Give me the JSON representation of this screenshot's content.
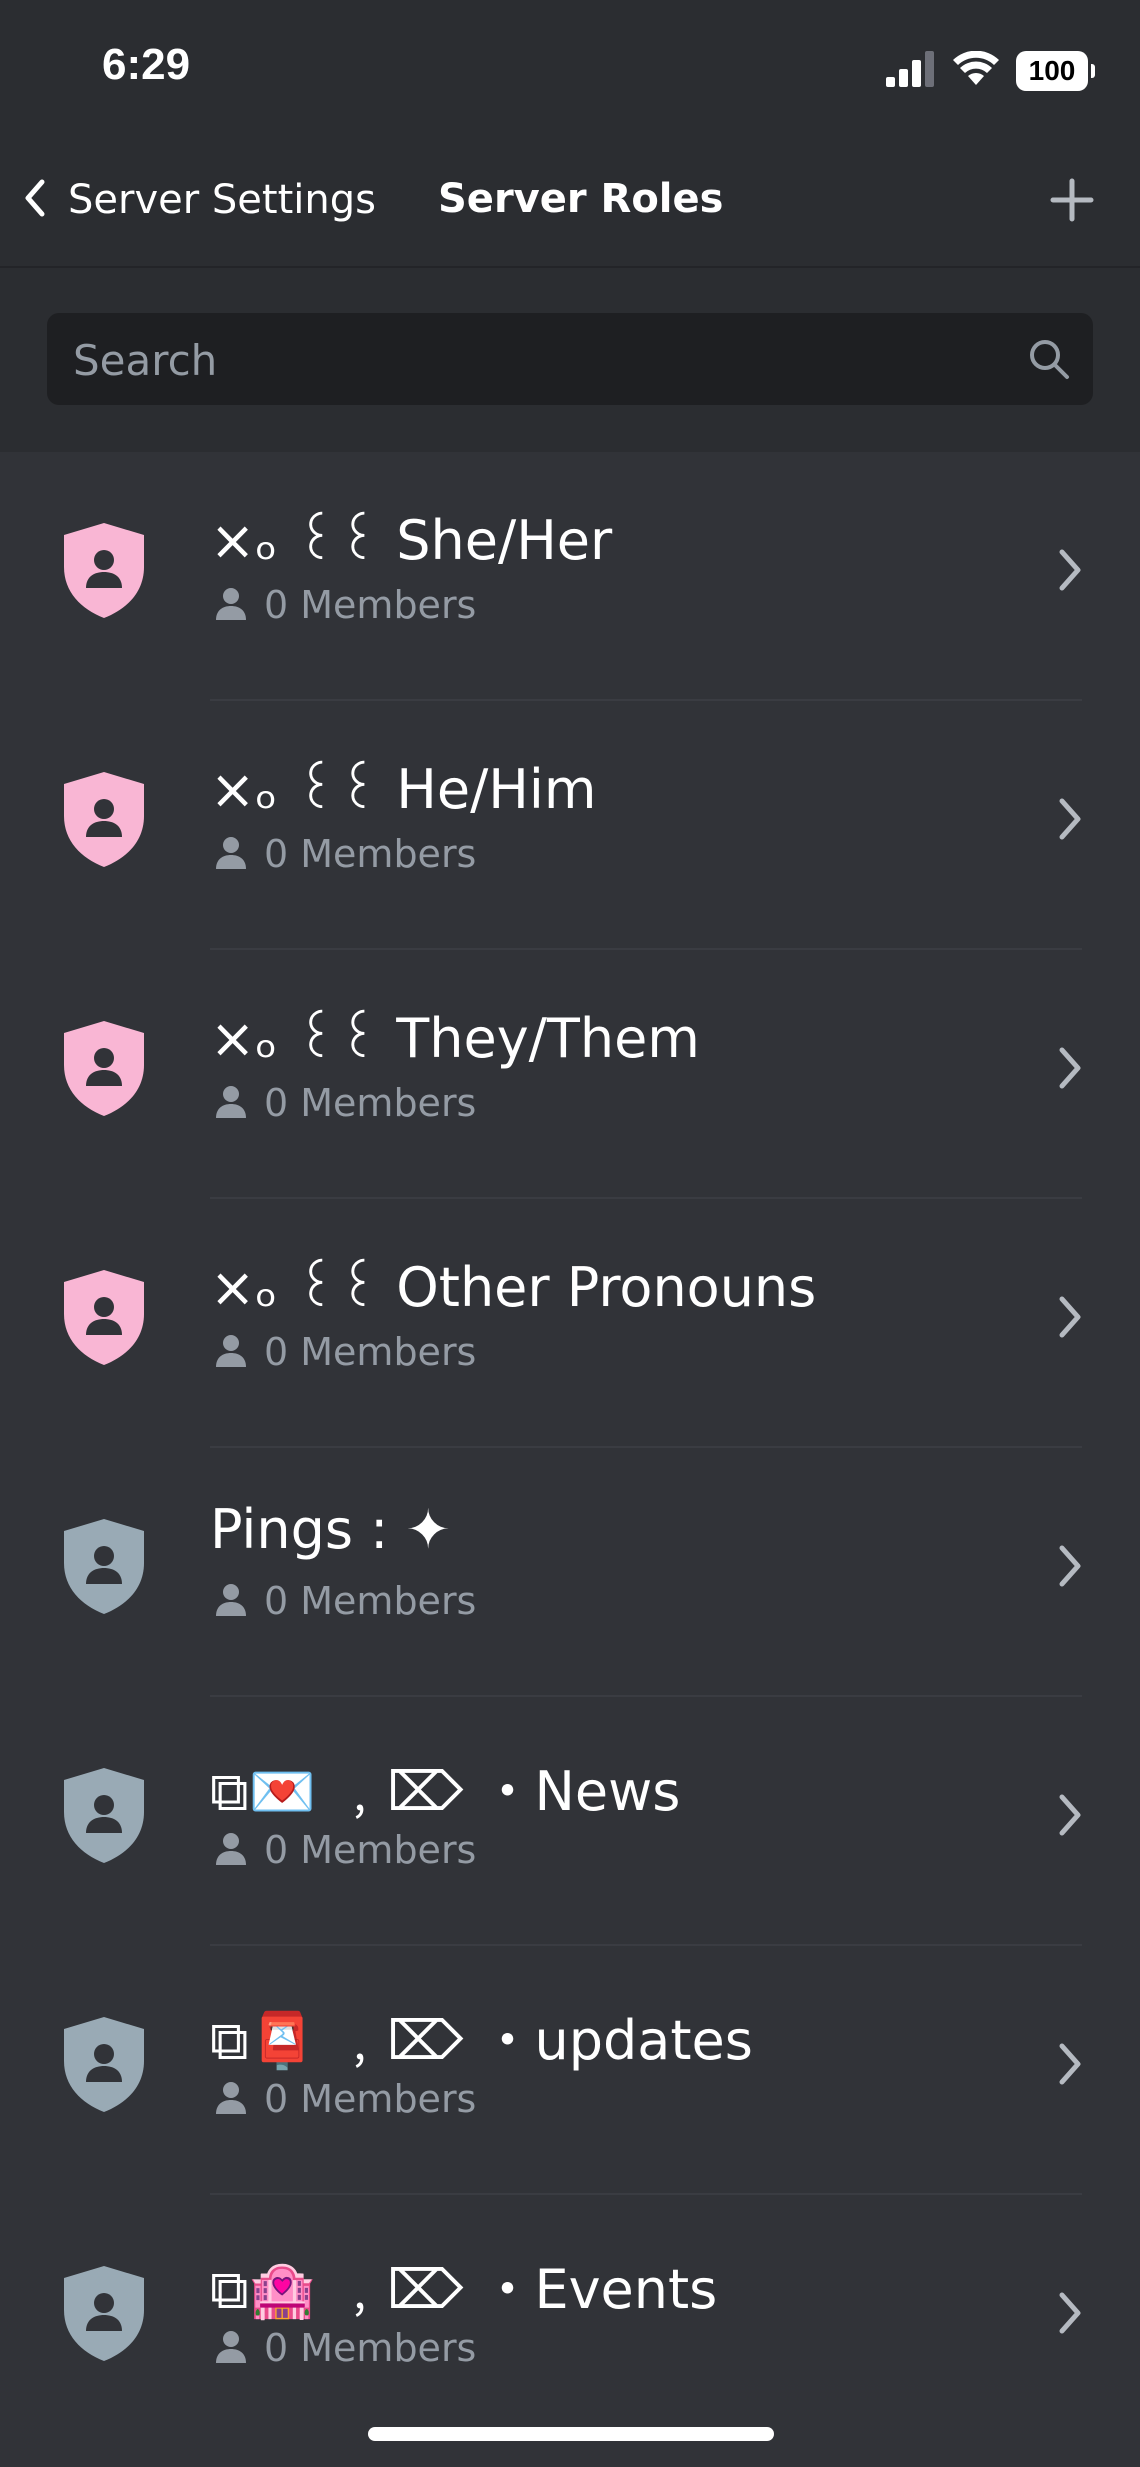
{
  "status_bar": {
    "time": "6:29",
    "battery": "100"
  },
  "nav": {
    "back_label": "Server Settings",
    "title": "Server Roles",
    "add_icon": "plus-icon"
  },
  "search": {
    "placeholder": "Search",
    "value": ""
  },
  "colors": {
    "background": "#313338",
    "header_bg": "#2b2d31",
    "search_bg": "#1e1f22",
    "muted_text": "#949ba4",
    "pronoun_role_color": "#f9b6d4",
    "default_role_color": "#99aab5"
  },
  "roles": [
    {
      "name": "×ₒ ꒰꒰ She/Her",
      "members": "0 Members",
      "color": "#f9b6d4"
    },
    {
      "name": "×ₒ ꒰꒰ He/Him",
      "members": "0 Members",
      "color": "#f9b6d4"
    },
    {
      "name": "×ₒ ꒰꒰ They/Them",
      "members": "0 Members",
      "color": "#f9b6d4"
    },
    {
      "name": "×ₒ ꒰꒰ Other Pronouns",
      "members": "0 Members",
      "color": "#f9b6d4"
    },
    {
      "name": "Pings : ✦",
      "members": "0 Members",
      "color": "#99aab5"
    },
    {
      "name": "⧉💌 ﹐⌦ ・News",
      "members": "0 Members",
      "color": "#99aab5"
    },
    {
      "name": "⧉📮 ﹐⌦ ・updates",
      "members": "0 Members",
      "color": "#99aab5"
    },
    {
      "name": "⧉🏩 ﹐⌦ ・Events",
      "members": "0 Members",
      "color": "#99aab5"
    }
  ]
}
